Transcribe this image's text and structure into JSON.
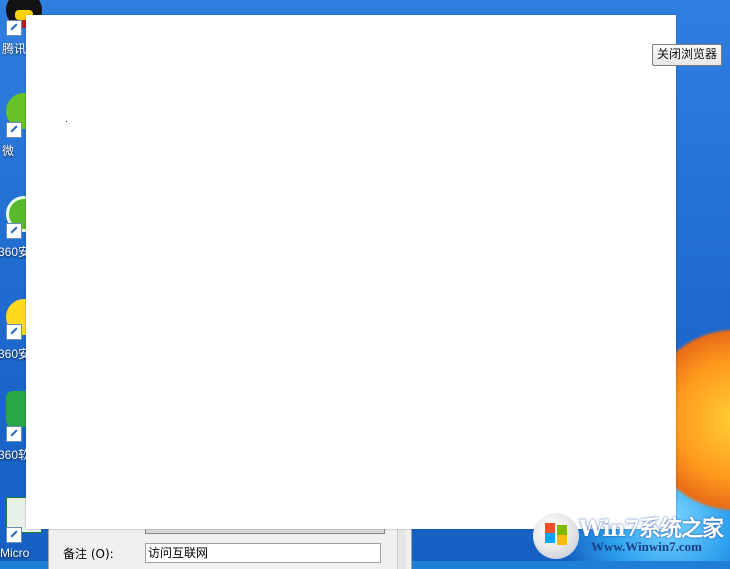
{
  "desktop": {
    "icons": [
      {
        "id": "qq",
        "label": "腾讯"
      },
      {
        "id": "wechat",
        "label": "微"
      },
      {
        "id": "360-safe",
        "label": "360安"
      },
      {
        "id": "360-browser",
        "label": "360安"
      },
      {
        "id": "360-software",
        "label": "360软"
      },
      {
        "id": "excel",
        "label": "Micro"
      }
    ]
  },
  "close_browser_button": {
    "label": "关闭浏览器"
  },
  "dialog": {
    "note_label": "备注 (O):",
    "note_value": "访问互联网"
  },
  "watermark": {
    "brand": "Win7系统之家",
    "url": "Www.Winwin7.com"
  }
}
